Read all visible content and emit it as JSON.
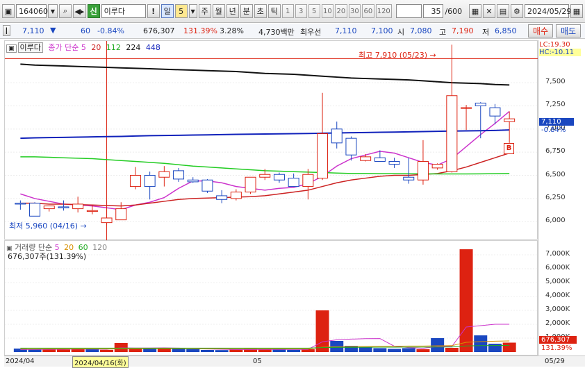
{
  "toolbar": {
    "code": "164060",
    "badge": "신",
    "stock_name": "이루다",
    "warn": "!",
    "period_selected": "일",
    "period_count": "5",
    "periods": [
      "주",
      "월",
      "년",
      "분",
      "초",
      "틱"
    ],
    "intervals": [
      "1",
      "3",
      "5",
      "10",
      "20",
      "30",
      "60",
      "120"
    ],
    "page_count": "35",
    "page_total": "/600",
    "date": "2024/05/29"
  },
  "quote": {
    "price": "7,110",
    "arrow": "▼",
    "change": "60",
    "change_pct": "-0.84%",
    "volume": "676,307",
    "vol_ratio": "131.39%",
    "turnover": "3.28%",
    "amount": "4,730백만",
    "hoga_label": "최우선",
    "best_ask": "7,110",
    "best_bid": "7,100",
    "open_label": "시",
    "open": "7,080",
    "high_label": "고",
    "high": "7,190",
    "low_label": "저",
    "low": "6,850",
    "buy_label": "매수",
    "sell_label": "매도"
  },
  "price_legend": {
    "name": "이루다",
    "close_label": "종가 단순",
    "ma": [
      "5",
      "20",
      "112",
      "224",
      "448"
    ]
  },
  "annotations": {
    "high": "최고 7,910 (05/23)",
    "low": "최저 5,960 (04/16)",
    "signal": "B"
  },
  "volume_legend": {
    "label": "거래량 단순",
    "ma": [
      "5",
      "20",
      "60",
      "120"
    ],
    "summary": "676,307주(131.39%)"
  },
  "right_axis": {
    "lc": "LC:19.30",
    "hc": "HC:-10.11",
    "current_price": "7,110",
    "current_pct": "-0.84%",
    "current_volume": "676,307",
    "current_vol_pct": "131.39%"
  },
  "bottom_axis": {
    "start": "2024/04",
    "cursor": "2024/04/16(화)",
    "month": "05",
    "end": "05/29"
  },
  "colors": {
    "up": "#dd2211",
    "down": "#1a47c0",
    "ma5": "#cc33cc",
    "ma20": "#cc2222",
    "ma112": "#22cc22",
    "ma224": "#1122bb",
    "ma448": "#111111"
  },
  "chart_data": [
    {
      "type": "candlestick",
      "title": "이루다",
      "ylim": [
        5800,
        7950
      ],
      "yticks": [
        6000,
        6250,
        6500,
        6750,
        7000,
        7250,
        7500
      ],
      "ytick_labels": [
        "6,000",
        "6,250",
        "6,500",
        "6,750",
        "7,000",
        "7,250",
        "7,500"
      ],
      "candles": [
        {
          "o": 6200,
          "h": 6230,
          "l": 6130,
          "c": 6190
        },
        {
          "o": 6200,
          "h": 6210,
          "l": 6060,
          "c": 6060
        },
        {
          "o": 6140,
          "h": 6160,
          "l": 6110,
          "c": 6170
        },
        {
          "o": 6160,
          "h": 6230,
          "l": 6120,
          "c": 6150
        },
        {
          "o": 6140,
          "h": 6270,
          "l": 6100,
          "c": 6190
        },
        {
          "o": 6110,
          "h": 6180,
          "l": 6080,
          "c": 6120
        },
        {
          "o": 5990,
          "h": 6220,
          "l": 5960,
          "c": 6040
        },
        {
          "o": 6020,
          "h": 6210,
          "l": 6020,
          "c": 6140
        },
        {
          "o": 6380,
          "h": 6590,
          "l": 6350,
          "c": 6500
        },
        {
          "o": 6500,
          "h": 6540,
          "l": 6240,
          "c": 6380
        },
        {
          "o": 6480,
          "h": 6600,
          "l": 6380,
          "c": 6540
        },
        {
          "o": 6550,
          "h": 6580,
          "l": 6430,
          "c": 6460
        },
        {
          "o": 6450,
          "h": 6480,
          "l": 6420,
          "c": 6430
        },
        {
          "o": 6450,
          "h": 6460,
          "l": 6310,
          "c": 6330
        },
        {
          "o": 6280,
          "h": 6340,
          "l": 6200,
          "c": 6240
        },
        {
          "o": 6250,
          "h": 6350,
          "l": 6230,
          "c": 6320
        },
        {
          "o": 6320,
          "h": 6480,
          "l": 6300,
          "c": 6480
        },
        {
          "o": 6480,
          "h": 6570,
          "l": 6450,
          "c": 6510
        },
        {
          "o": 6510,
          "h": 6530,
          "l": 6420,
          "c": 6450
        },
        {
          "o": 6470,
          "h": 6520,
          "l": 6400,
          "c": 6380
        },
        {
          "o": 6380,
          "h": 6570,
          "l": 6240,
          "c": 6510
        },
        {
          "o": 6470,
          "h": 7390,
          "l": 6450,
          "c": 6950
        },
        {
          "o": 7000,
          "h": 7080,
          "l": 6790,
          "c": 6850
        },
        {
          "o": 6900,
          "h": 6920,
          "l": 6660,
          "c": 6720
        },
        {
          "o": 6660,
          "h": 6730,
          "l": 6650,
          "c": 6700
        },
        {
          "o": 6690,
          "h": 6770,
          "l": 6650,
          "c": 6650
        },
        {
          "o": 6650,
          "h": 6690,
          "l": 6580,
          "c": 6620
        },
        {
          "o": 6480,
          "h": 6690,
          "l": 6410,
          "c": 6450
        },
        {
          "o": 6450,
          "h": 6880,
          "l": 6400,
          "c": 6650
        },
        {
          "o": 6580,
          "h": 6630,
          "l": 6560,
          "c": 6620
        },
        {
          "o": 6540,
          "h": 7910,
          "l": 6530,
          "c": 7360
        },
        {
          "o": 7230,
          "h": 7260,
          "l": 6990,
          "c": 7230
        },
        {
          "o": 7280,
          "h": 7290,
          "l": 6900,
          "c": 7250
        },
        {
          "o": 7230,
          "h": 7270,
          "l": 7050,
          "c": 7140
        },
        {
          "o": 7080,
          "h": 7190,
          "l": 6850,
          "c": 7110
        }
      ],
      "series": [
        {
          "name": "5",
          "values": [
            6300,
            6250,
            6220,
            6190,
            6180,
            6170,
            6150,
            6130,
            6180,
            6210,
            6260,
            6360,
            6440,
            6440,
            6420,
            6380,
            6360,
            6340,
            6360,
            6370,
            6410,
            6490,
            6600,
            6680,
            6720,
            6760,
            6740,
            6690,
            6640,
            6610,
            6680,
            6810,
            6940,
            7060,
            7190
          ]
        },
        {
          "name": "20",
          "values": [
            6200,
            6200,
            6190,
            6190,
            6185,
            6180,
            6175,
            6170,
            6180,
            6200,
            6220,
            6240,
            6250,
            6255,
            6260,
            6265,
            6270,
            6280,
            6300,
            6320,
            6340,
            6380,
            6420,
            6450,
            6470,
            6490,
            6500,
            6500,
            6510,
            6520,
            6550,
            6590,
            6640,
            6690,
            6740
          ]
        },
        {
          "name": "112",
          "values": [
            6700,
            6700,
            6695,
            6690,
            6685,
            6680,
            6670,
            6660,
            6650,
            6640,
            6630,
            6615,
            6600,
            6590,
            6580,
            6570,
            6560,
            6550,
            6545,
            6540,
            6535,
            6530,
            6525,
            6520,
            6520,
            6518,
            6518,
            6517,
            6516,
            6515,
            6515,
            6515,
            6516,
            6518,
            6520
          ]
        },
        {
          "name": "224",
          "values": [
            6900,
            6905,
            6908,
            6910,
            6912,
            6915,
            6918,
            6920,
            6925,
            6928,
            6930,
            6932,
            6935,
            6937,
            6940,
            6942,
            6944,
            6946,
            6948,
            6950,
            6952,
            6955,
            6957,
            6960,
            6962,
            6965,
            6967,
            6970,
            6972,
            6975,
            6978,
            6980,
            6982,
            6985,
            6990
          ]
        },
        {
          "name": "448",
          "values": [
            7700,
            7690,
            7685,
            7680,
            7675,
            7670,
            7665,
            7660,
            7655,
            7650,
            7645,
            7640,
            7635,
            7630,
            7625,
            7620,
            7610,
            7600,
            7595,
            7590,
            7580,
            7570,
            7560,
            7550,
            7545,
            7540,
            7535,
            7530,
            7520,
            7510,
            7500,
            7495,
            7490,
            7480,
            7475
          ]
        }
      ]
    },
    {
      "type": "bar",
      "title": "거래량",
      "ylim": [
        0,
        8000000
      ],
      "yticks": [
        1000000,
        2000000,
        3000000,
        4000000,
        5000000,
        6000000,
        7000000
      ],
      "ytick_labels": [
        "1,000K",
        "2,000K",
        "3,000K",
        "4,000K",
        "5,000K",
        "6,000K",
        "7,000K"
      ],
      "values": [
        250000,
        200000,
        200000,
        180000,
        210000,
        230000,
        160000,
        650000,
        220000,
        270000,
        260000,
        240000,
        210000,
        150000,
        140000,
        170000,
        230000,
        200000,
        180000,
        160000,
        200000,
        3000000,
        800000,
        450000,
        350000,
        280000,
        230000,
        280000,
        200000,
        1000000,
        300000,
        7400000,
        1200000,
        600000,
        676307
      ],
      "up": [
        false,
        false,
        true,
        true,
        true,
        false,
        true,
        true,
        true,
        false,
        true,
        false,
        false,
        false,
        false,
        true,
        true,
        true,
        false,
        false,
        true,
        true,
        false,
        false,
        false,
        false,
        false,
        false,
        true,
        false,
        true,
        true,
        false,
        false,
        true
      ],
      "series": [
        {
          "name": "5",
          "values": [
            180000,
            190000,
            195000,
            200000,
            210000,
            215000,
            205000,
            300000,
            290000,
            290000,
            300000,
            280000,
            240000,
            220000,
            200000,
            180000,
            180000,
            190000,
            190000,
            190000,
            190000,
            740000,
            880000,
            930000,
            960000,
            970000,
            420000,
            320000,
            270000,
            400000,
            400000,
            1800000,
            1900000,
            2000000,
            2000000
          ]
        },
        {
          "name": "20",
          "values": [
            220000,
            220000,
            225000,
            225000,
            225000,
            225000,
            225000,
            240000,
            240000,
            245000,
            245000,
            245000,
            245000,
            240000,
            235000,
            230000,
            230000,
            230000,
            225000,
            225000,
            225000,
            350000,
            380000,
            400000,
            410000,
            420000,
            420000,
            430000,
            430000,
            450000,
            460000,
            700000,
            750000,
            780000,
            800000
          ]
        },
        {
          "name": "60",
          "values": [
            280000,
            280000,
            280000,
            280000,
            280000,
            280000,
            280000,
            280000,
            280000,
            280000,
            280000,
            280000,
            280000,
            280000,
            280000,
            280000,
            280000,
            280000,
            280000,
            280000,
            280000,
            320000,
            330000,
            340000,
            345000,
            350000,
            350000,
            355000,
            355000,
            360000,
            365000,
            440000,
            460000,
            470000,
            480000
          ]
        }
      ]
    }
  ]
}
